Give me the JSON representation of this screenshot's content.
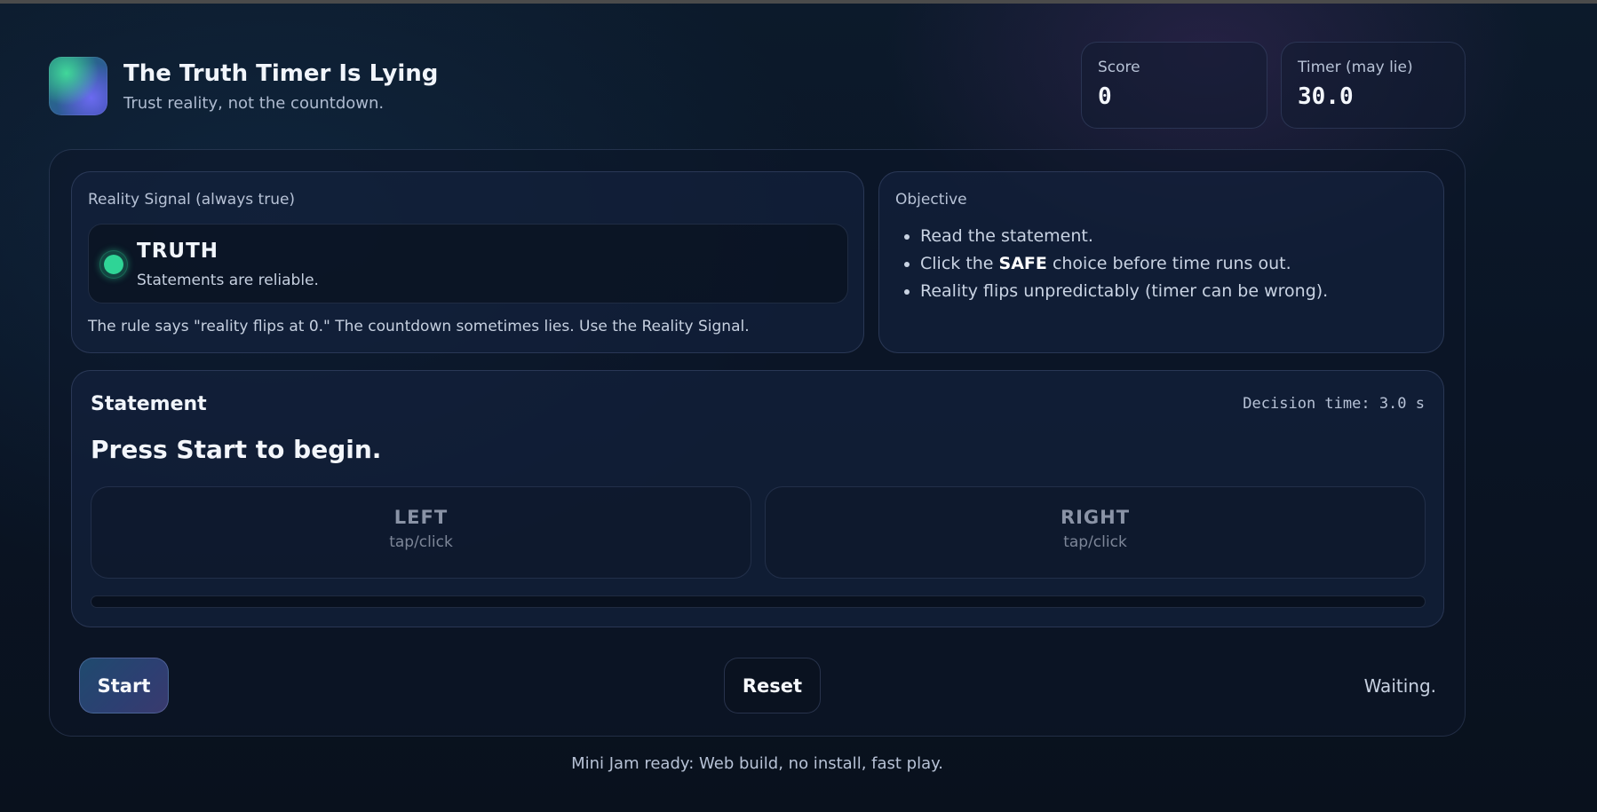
{
  "app": {
    "title": "The Truth Timer Is Lying",
    "subtitle": "Trust reality, not the countdown.",
    "logo_icon": "gradient-orb-logo"
  },
  "stats": {
    "score_label": "Score",
    "score_value": "0",
    "timer_label": "Timer (may lie)",
    "timer_value": "30.0"
  },
  "reality": {
    "label": "Reality Signal (always true)",
    "state": "TRUTH",
    "description": "Statements are reliable.",
    "indicator_color": "#2fd496",
    "rule_note": "The rule says \"reality flips at 0.\" The countdown sometimes lies. Use the Reality Signal."
  },
  "objective": {
    "label": "Objective",
    "items": [
      {
        "text": "Read the statement."
      },
      {
        "before": "Click the ",
        "strong": "SAFE",
        "after": " choice before time runs out."
      },
      {
        "text": "Reality flips unpredictably (timer can be wrong)."
      }
    ]
  },
  "statement": {
    "heading": "Statement",
    "decision_time": "Decision time: 3.0 s",
    "text": "Press Start to begin.",
    "choices": [
      {
        "title": "LEFT",
        "hint": "tap/click"
      },
      {
        "title": "RIGHT",
        "hint": "tap/click"
      }
    ],
    "progress": 0
  },
  "controls": {
    "start_label": "Start",
    "reset_label": "Reset",
    "status": "Waiting."
  },
  "footer": {
    "note": "Mini Jam ready: Web build, no install, fast play."
  },
  "colors": {
    "background": "#0a1424",
    "accent": "#2fd496",
    "start_button": "#2d3f72"
  }
}
